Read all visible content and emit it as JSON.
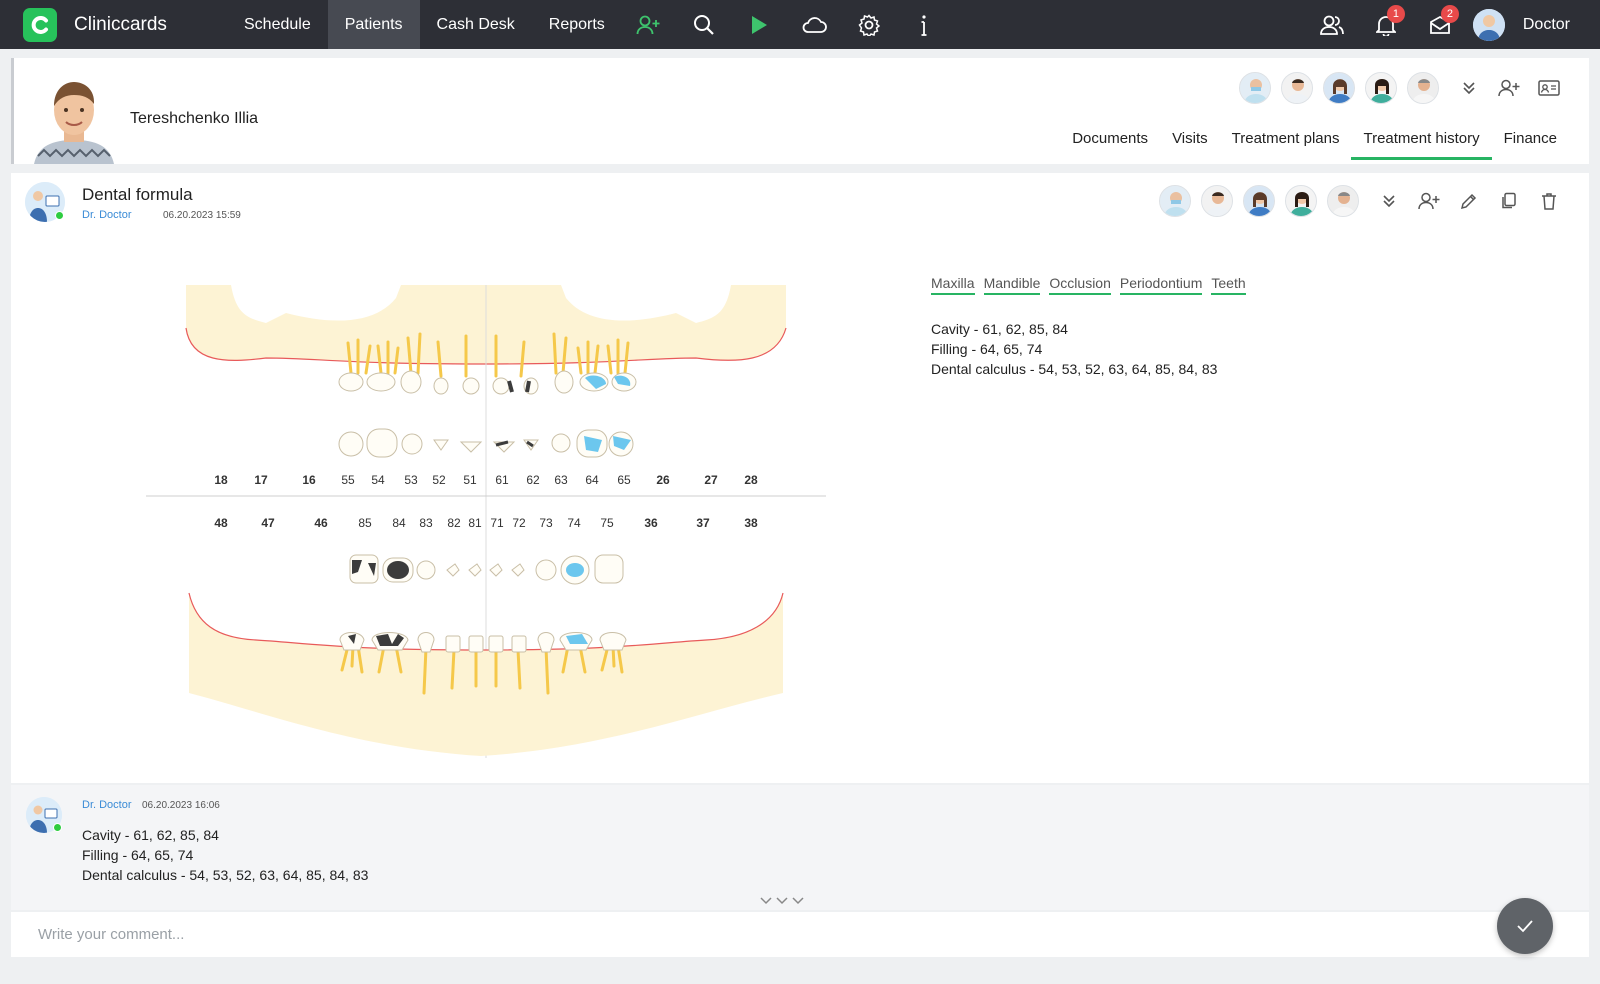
{
  "app": {
    "name": "Cliniccards",
    "brand_color": "#27c25b",
    "nav": [
      {
        "label": "Schedule"
      },
      {
        "label": "Patients"
      },
      {
        "label": "Cash Desk"
      },
      {
        "label": "Reports"
      }
    ],
    "nav_icons": [
      "add-user-icon",
      "search-icon",
      "play-icon",
      "cloud-icon",
      "gear-icon",
      "info-icon"
    ],
    "notifications_count": "1",
    "messages_count": "2",
    "user_name": "Doctor"
  },
  "patient": {
    "name": "Tereshchenko Illia",
    "tabs": [
      {
        "label": "Documents"
      },
      {
        "label": "Visits"
      },
      {
        "label": "Treatment plans"
      },
      {
        "label": "Treatment history"
      },
      {
        "label": "Finance"
      }
    ],
    "active_tab": "Treatment history"
  },
  "record": {
    "title": "Dental formula",
    "author": "Dr. Doctor",
    "date": "06.20.2023 15:59"
  },
  "dental_chart": {
    "upper_numbers": [
      "18",
      "17",
      "16",
      "55",
      "54",
      "53",
      "52",
      "51",
      "61",
      "62",
      "63",
      "64",
      "65",
      "26",
      "27",
      "28"
    ],
    "lower_numbers": [
      "48",
      "47",
      "46",
      "85",
      "84",
      "83",
      "82",
      "81",
      "71",
      "72",
      "73",
      "74",
      "75",
      "36",
      "37",
      "38"
    ]
  },
  "formula_tabs": [
    "Maxilla",
    "Mandible",
    "Occlusion",
    "Periodontium",
    "Teeth"
  ],
  "findings": [
    "Cavity - 61, 62, 85, 84",
    "Filling - 64, 65, 74",
    "Dental calculus - 54, 53, 52, 63, 64, 85, 84, 83"
  ],
  "comment": {
    "author": "Dr. Doctor",
    "date": "06.20.2023 16:06",
    "lines": [
      "Cavity - 61, 62, 85, 84",
      "Filling - 64, 65, 74",
      "Dental calculus - 54, 53, 52, 63, 64, 85, 84, 83"
    ]
  },
  "input": {
    "placeholder": "Write your comment..."
  },
  "colors": {
    "gum": "#fdf3d4",
    "gum_line": "#e85a5a",
    "root": "#f5c84a",
    "filling": "#6cc7ee",
    "cavity": "#3c3c3c",
    "active_tab": "#28b463"
  }
}
